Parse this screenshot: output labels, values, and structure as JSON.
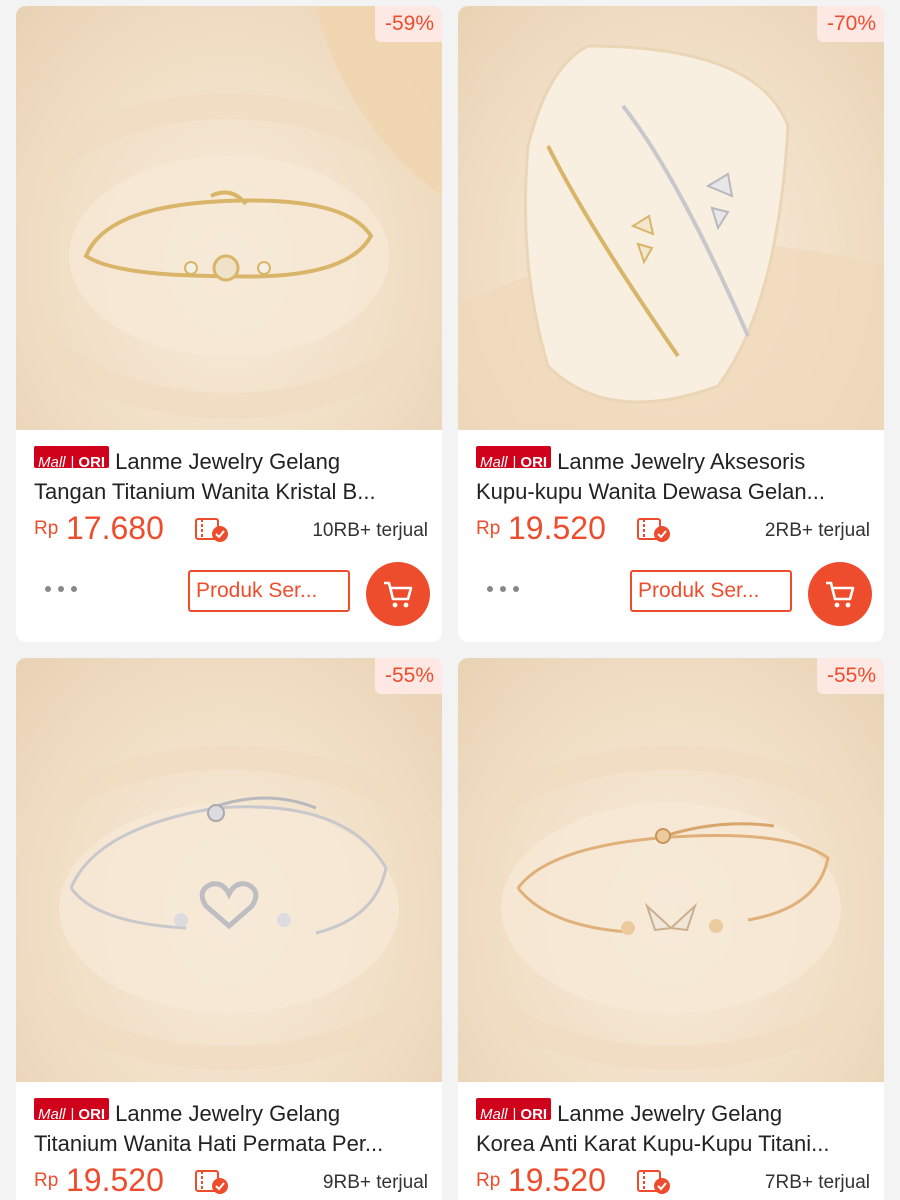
{
  "products": [
    {
      "discount": "-59%",
      "badge": {
        "mall": "Mall",
        "sep": "|",
        "ori": "ORI"
      },
      "title_line1": "Lanme Jewelry Gelang",
      "title_line2": "Tangan Titanium Wanita Kristal B...",
      "currency": "Rp",
      "price": "17.680",
      "sold": "10RB+ terjual",
      "button_label": "Produk Ser...",
      "metal": "gold",
      "charm": "flower",
      "colors": {
        "metal": "#d9b56a"
      }
    },
    {
      "discount": "-70%",
      "badge": {
        "mall": "Mall",
        "sep": "|",
        "ori": "ORI"
      },
      "title_line1": "Lanme Jewelry Aksesoris",
      "title_line2": "Kupu-kupu Wanita Dewasa Gelan...",
      "currency": "Rp",
      "price": "19.520",
      "sold": "2RB+ terjual",
      "button_label": "Produk Ser...",
      "metal": "gold-and-silver",
      "charm": "butterfly",
      "colors": {
        "metal": "#d9b56a"
      }
    },
    {
      "discount": "-55%",
      "badge": {
        "mall": "Mall",
        "sep": "|",
        "ori": "ORI"
      },
      "title_line1": "Lanme Jewelry Gelang",
      "title_line2": "Titanium Wanita Hati Permata Per...",
      "currency": "Rp",
      "price": "19.520",
      "sold": "9RB+ terjual",
      "metal": "silver",
      "charm": "heart",
      "colors": {
        "metal": "#c8c8cc"
      }
    },
    {
      "discount": "-55%",
      "badge": {
        "mall": "Mall",
        "sep": "|",
        "ori": "ORI"
      },
      "title_line1": "Lanme Jewelry Gelang",
      "title_line2": "Korea Anti Karat Kupu-Kupu Titani...",
      "currency": "Rp",
      "price": "19.520",
      "sold": "7RB+ terjual",
      "metal": "rose-gold",
      "charm": "butterfly",
      "colors": {
        "metal": "#e0b07a"
      }
    }
  ],
  "theme": {
    "accent": "#ee4d2d",
    "mall_red": "#d0011b"
  }
}
